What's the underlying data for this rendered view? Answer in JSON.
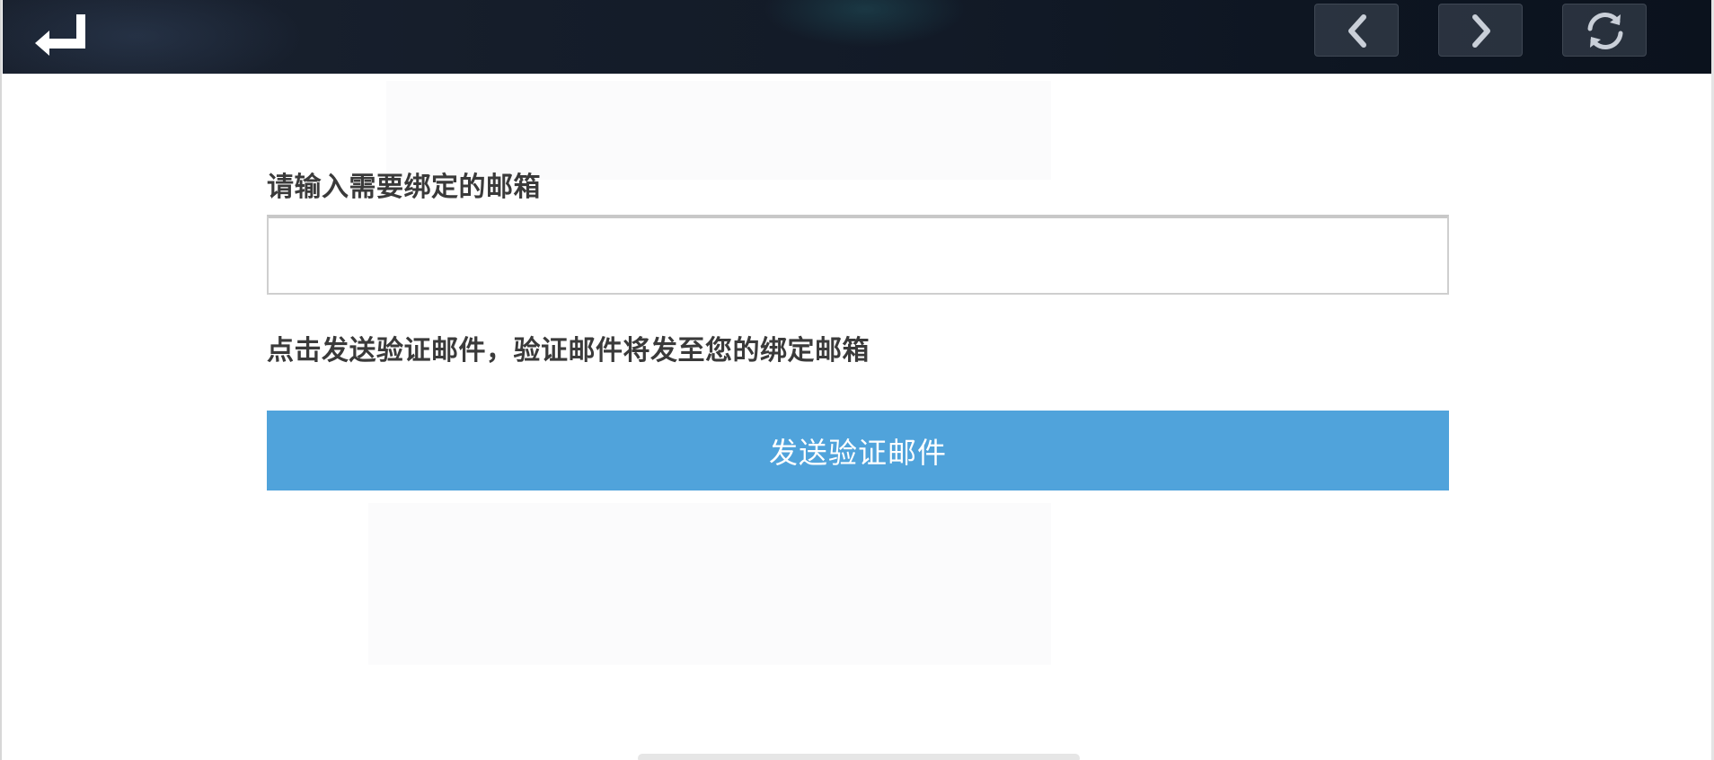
{
  "topbar": {
    "back_icon": "return-arrow-icon",
    "prev_icon": "chevron-left-icon",
    "next_icon": "chevron-right-icon",
    "refresh_icon": "refresh-icon"
  },
  "form": {
    "email_label": "请输入需要绑定的邮箱",
    "email_value": "",
    "email_placeholder": "",
    "hint": "点击发送验证邮件，验证邮件将发至您的绑定邮箱",
    "send_button_label": "发送验证邮件"
  },
  "colors": {
    "topbar_bg": "#121a27",
    "button_accent": "#50a3db",
    "text": "#3a3a3a"
  }
}
